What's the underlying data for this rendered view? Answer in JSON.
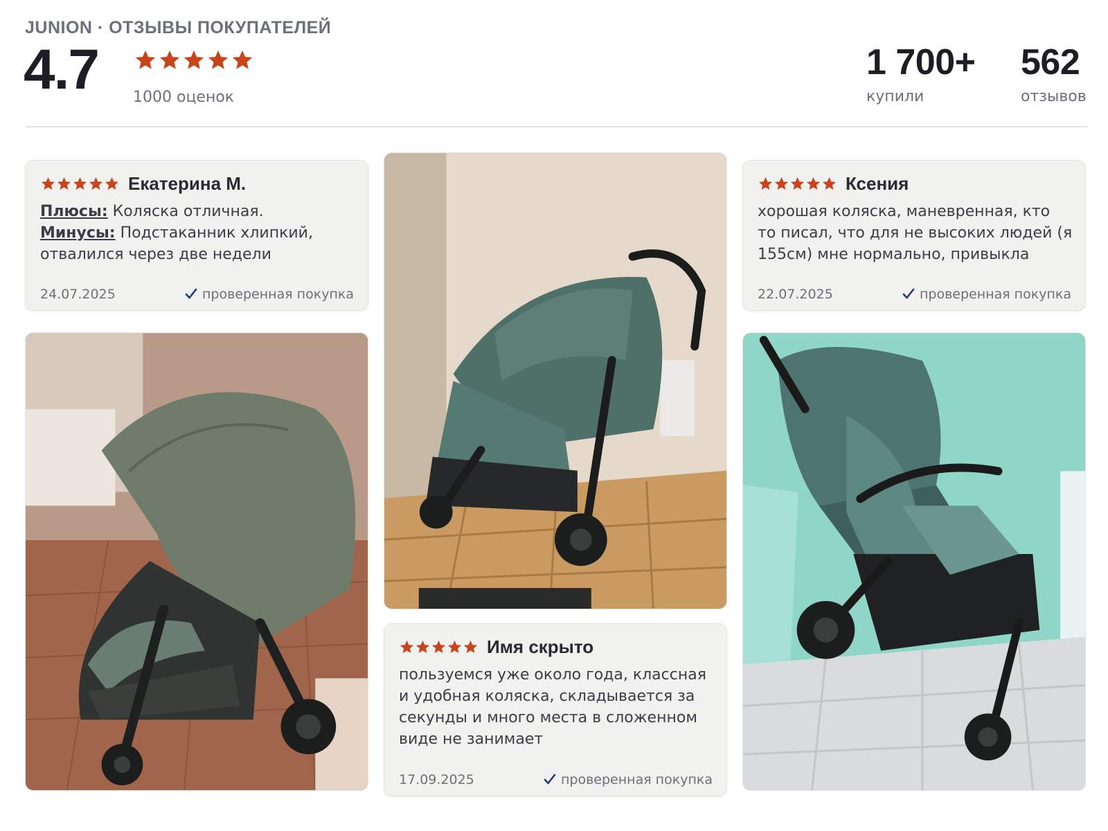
{
  "header": {
    "brand": "JUNION · ОТЗЫВЫ ПОКУПАТЕЛЕЙ",
    "rating": "4.7",
    "rating_stars": 5,
    "ratings_count": "1000 оценок",
    "bought_value": "1 700+",
    "bought_label": "купили",
    "reviews_value": "562",
    "reviews_label": "отзывов"
  },
  "colors": {
    "star": "#c8451b",
    "verified_check": "#1f3a73",
    "card_bg": "#f1f1ef"
  },
  "reviews": [
    {
      "author": "Екатерина М.",
      "stars": 5,
      "pros_label": "Плюсы:",
      "pros_text": " Коляска отличная.",
      "cons_label": "Минусы:",
      "cons_text": " Подстаканник хлипкий, отвалился через две недели",
      "date": "24.07.2025",
      "verified": "проверенная покупка"
    },
    {
      "author": "Ксения",
      "stars": 5,
      "text": "хорошая коляска, маневренная, кто то писал, что для не высоких людей (я 155см) мне нормально, привыкла",
      "date": "22.07.2025",
      "verified": "проверенная покупка"
    },
    {
      "author": "Имя скрыто",
      "stars": 5,
      "text": "пользуемся уже около года, классная и удобная коляска, складывается за секунды и много места в сложенном виде не занимает",
      "date": "17.09.2025",
      "verified": "проверенная покупка"
    }
  ],
  "photos": [
    {
      "name": "review-photo-stroller-kitchen",
      "icon": "stroller-photo"
    },
    {
      "name": "review-photo-stroller-corner",
      "icon": "stroller-photo"
    },
    {
      "name": "review-photo-stroller-hallway",
      "icon": "stroller-photo"
    }
  ]
}
